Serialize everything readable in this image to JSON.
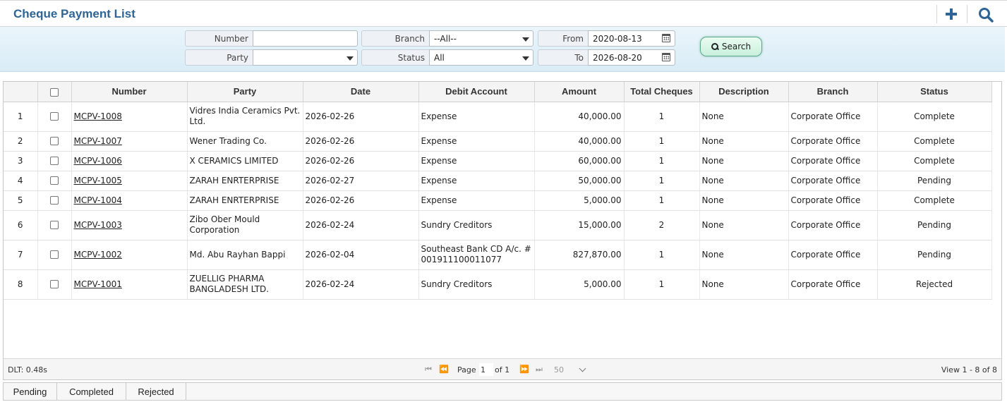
{
  "header": {
    "title": "Cheque Payment List",
    "add_icon": "plus-icon",
    "search_icon": "search-icon",
    "accent": "#2e6596"
  },
  "filters": {
    "number": {
      "label": "Number",
      "value": ""
    },
    "party": {
      "label": "Party",
      "value": ""
    },
    "branch": {
      "label": "Branch",
      "value": "--All--"
    },
    "status": {
      "label": "Status",
      "value": "All"
    },
    "from": {
      "label": "From",
      "value": "2020-08-13"
    },
    "to": {
      "label": "To",
      "value": "2026-08-20"
    },
    "search_button": "Search"
  },
  "table": {
    "columns": [
      "",
      "",
      "Number",
      "Party",
      "Date",
      "Debit Account",
      "Amount",
      "Total Cheques",
      "Description",
      "Branch",
      "Status"
    ],
    "rows": [
      {
        "idx": "1",
        "number": "MCPV-1008",
        "party": "Vidres India Ceramics Pvt. Ltd.",
        "date": "2026-02-26",
        "debit": "Expense",
        "amount": "40,000.00",
        "cheques": "1",
        "desc": "None",
        "branch": "Corporate Office",
        "status": "Complete",
        "tall": true
      },
      {
        "idx": "2",
        "number": "MCPV-1007",
        "party": "Wener Trading Co.",
        "date": "2026-02-26",
        "debit": "Expense",
        "amount": "40,000.00",
        "cheques": "1",
        "desc": "None",
        "branch": "Corporate Office",
        "status": "Complete",
        "tall": false
      },
      {
        "idx": "3",
        "number": "MCPV-1006",
        "party": "X CERAMICS LIMITED",
        "date": "2026-02-26",
        "debit": "Expense",
        "amount": "60,000.00",
        "cheques": "1",
        "desc": "None",
        "branch": "Corporate Office",
        "status": "Complete",
        "tall": false
      },
      {
        "idx": "4",
        "number": "MCPV-1005",
        "party": "ZARAH ENRTERPRISE",
        "date": "2026-02-27",
        "debit": "Expense",
        "amount": "50,000.00",
        "cheques": "1",
        "desc": "None",
        "branch": "Corporate Office",
        "status": "Pending",
        "tall": false
      },
      {
        "idx": "5",
        "number": "MCPV-1004",
        "party": "ZARAH ENRTERPRISE",
        "date": "2026-02-26",
        "debit": "Expense",
        "amount": "5,000.00",
        "cheques": "1",
        "desc": "None",
        "branch": "Corporate Office",
        "status": "Complete",
        "tall": false
      },
      {
        "idx": "6",
        "number": "MCPV-1003",
        "party": "Zibo Ober Mould Corporation",
        "date": "2026-02-24",
        "debit": "Sundry Creditors",
        "amount": "15,000.00",
        "cheques": "2",
        "desc": "None",
        "branch": "Corporate Office",
        "status": "Pending",
        "tall": true
      },
      {
        "idx": "7",
        "number": "MCPV-1002",
        "party": "Md. Abu Rayhan Bappi",
        "date": "2026-02-04",
        "debit": "Southeast  Bank CD A/c. # 001911100011077",
        "amount": "827,870.00",
        "cheques": "1",
        "desc": "None",
        "branch": "Corporate Office",
        "status": "Pending",
        "tall": true
      },
      {
        "idx": "8",
        "number": "MCPV-1001",
        "party": "ZUELLIG PHARMA BANGLADESH LTD.",
        "date": "2026-02-24",
        "debit": "Sundry Creditors",
        "amount": "5,000.00",
        "cheques": "1",
        "desc": "None",
        "branch": "Corporate Office",
        "status": "Rejected",
        "tall": true
      }
    ]
  },
  "pager": {
    "dlt": "DLT: 0.48s",
    "page_label": "Page",
    "page_value": "1",
    "of_label": "of 1",
    "page_size": "50",
    "view": "View 1 - 8 of 8"
  },
  "tabs": [
    "Pending",
    "Completed",
    "Rejected"
  ]
}
